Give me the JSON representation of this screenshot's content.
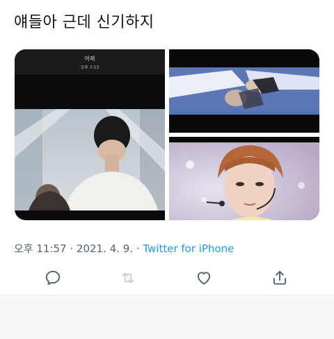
{
  "tweet": {
    "text": "얘들아 근데 신기하지"
  },
  "media": {
    "screenshot_title": "어제",
    "screenshot_time": "오후 7:53"
  },
  "meta": {
    "time": "오후 11:57",
    "separator1": " · ",
    "date": "2021. 4. 9.",
    "separator2": " · ",
    "source": "Twitter for iPhone"
  },
  "actions": {
    "reply_icon": "reply-icon",
    "retweet_icon": "retweet-icon",
    "like_icon": "heart-icon",
    "share_icon": "share-icon"
  },
  "colors": {
    "text": "#0f1419",
    "secondary": "#536471",
    "link": "#1d9bf0",
    "disabled": "#c8d1d8"
  }
}
